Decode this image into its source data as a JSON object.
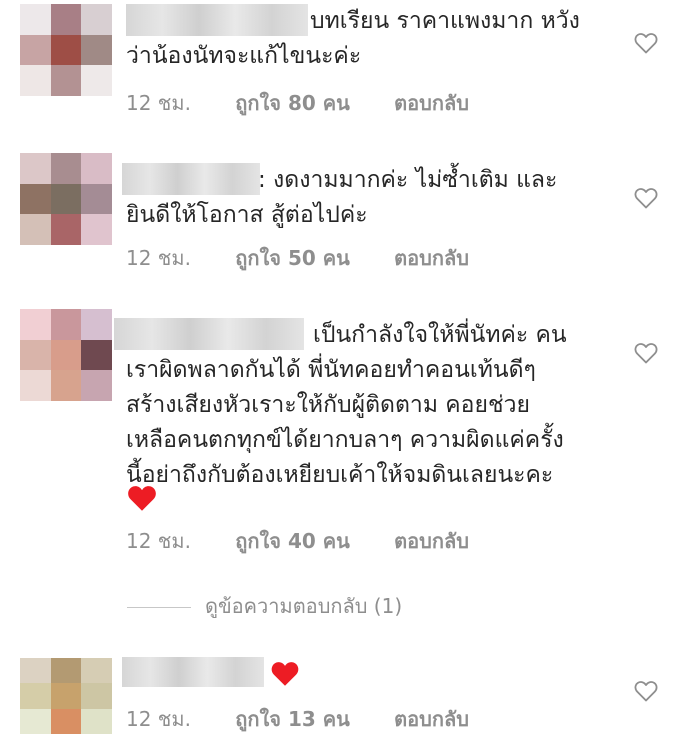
{
  "comments": [
    {
      "text_lines": [
        "บทเรียน ราคาแพงมาก หวัง",
        "ว่าน้องนัทจะแก้ไขนะค่ะ"
      ],
      "time": "12 ชม.",
      "likes": "ถูกใจ 80 คน",
      "reply": "ตอบกลับ"
    },
    {
      "text_lines": [
        ": งดงามมากค่ะ  ไม่ซ้ำเติม และ",
        "ยินดีให้โอกาส สู้ต่อไปค่ะ"
      ],
      "time": "12 ชม.",
      "likes": "ถูกใจ 50 คน",
      "reply": "ตอบกลับ"
    },
    {
      "text_lines": [
        "เป็นกำลังใจให้พี่นัทค่ะ คน",
        "เราผิดพลาดกันได้ พี่นัทคอยทำคอนเท้นดีๆ",
        "สร้างเสียงหัวเราะให้กับผู้ติดตาม คอยช่วย",
        "เหลือคนตกทุกข์ได้ยากบลาๆ ความผิดแค่ครั้ง",
        "นี้อย่าถึงกับต้องเหยียบเค้าให้จมดินเลยนะคะ"
      ],
      "time": "12 ชม.",
      "likes": "ถูกใจ 40 คน",
      "reply": "ตอบกลับ"
    },
    {
      "text_lines": [],
      "time": "12 ชม.",
      "likes": "ถูกใจ 13 คน",
      "reply": "ตอบกลับ"
    }
  ],
  "view_replies": "ดูข้อความตอบกลับ (1)",
  "icons": {
    "like": "heart-outline-icon",
    "emoji": "red-heart-emoji"
  },
  "colors": {
    "text": "#262626",
    "meta": "#8e8e8e",
    "emoji_red": "#ed1c24"
  }
}
